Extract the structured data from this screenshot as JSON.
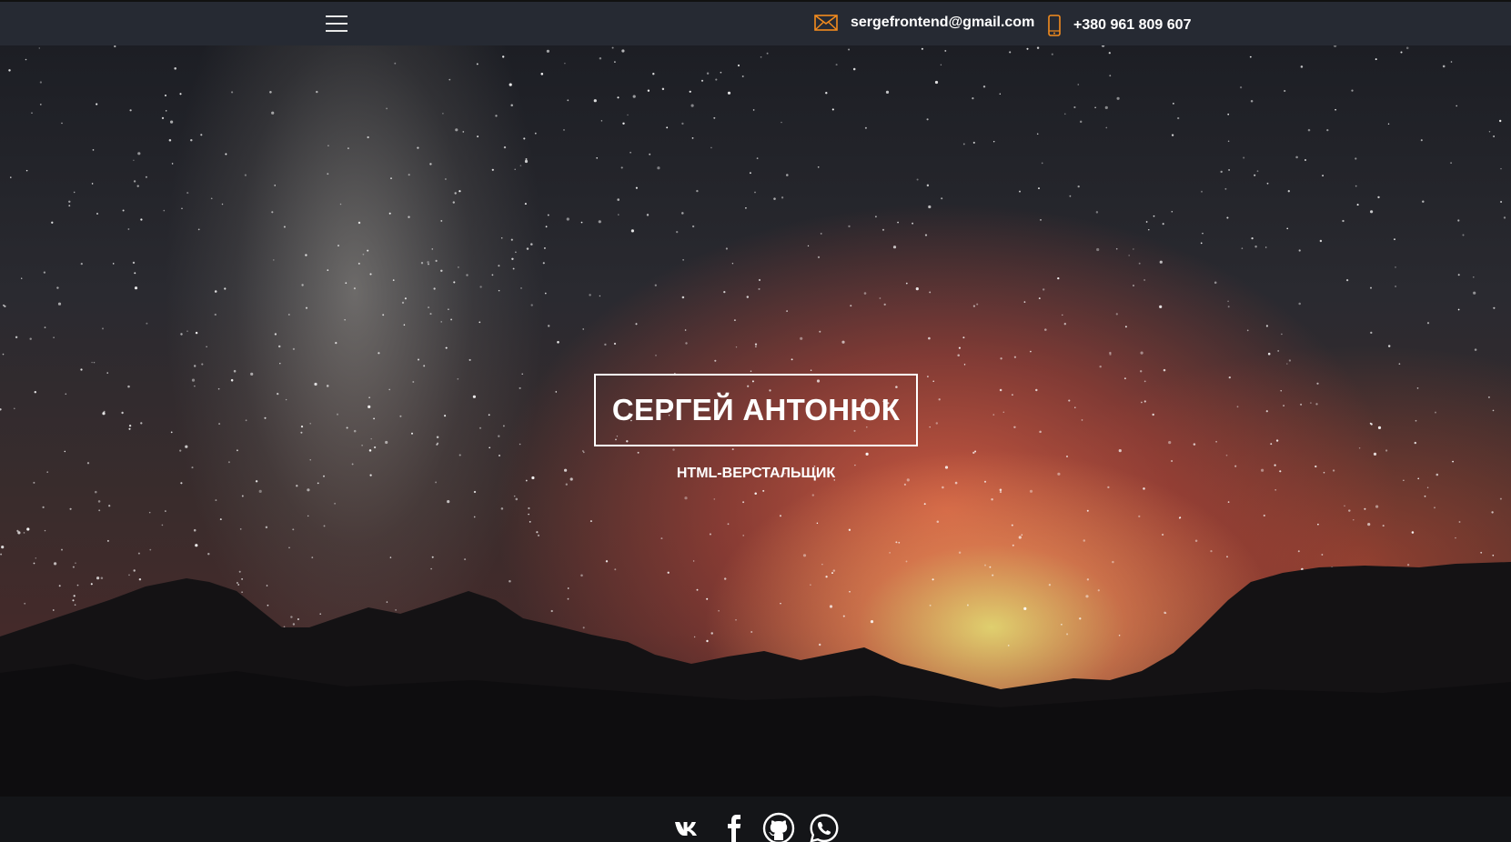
{
  "header": {
    "menu_icon": "hamburger-menu-icon",
    "email": "sergefrontend@gmail.com",
    "email_icon": "envelope-icon",
    "phone": "+380 961 809 607",
    "phone_icon": "mobile-phone-icon",
    "accent_color": "#f28b1e"
  },
  "hero": {
    "name": "СЕРГЕЙ АНТОНЮК",
    "role": "HTML-ВЕРСТАЛЬЩИК"
  },
  "footer": {
    "social": [
      {
        "icon": "vk-icon"
      },
      {
        "icon": "facebook-icon"
      },
      {
        "icon": "github-icon"
      },
      {
        "icon": "whatsapp-icon"
      }
    ]
  }
}
